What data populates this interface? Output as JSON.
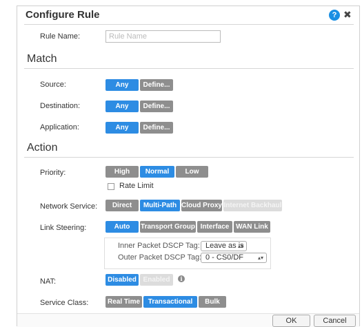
{
  "dialog": {
    "title": "Configure Rule",
    "help_glyph": "?",
    "close_glyph": "✖"
  },
  "rule_name": {
    "label": "Rule Name:",
    "placeholder": "Rule Name",
    "value": ""
  },
  "match": {
    "heading": "Match",
    "source": {
      "label": "Source:",
      "options": [
        "Any",
        "Define..."
      ],
      "selected": "Any"
    },
    "destination": {
      "label": "Destination:",
      "options": [
        "Any",
        "Define..."
      ],
      "selected": "Any"
    },
    "application": {
      "label": "Application:",
      "options": [
        "Any",
        "Define..."
      ],
      "selected": "Any"
    }
  },
  "action": {
    "heading": "Action",
    "priority": {
      "label": "Priority:",
      "options": [
        "High",
        "Normal",
        "Low"
      ],
      "selected": "Normal"
    },
    "rate_limit": {
      "label": "Rate Limit",
      "checked": false
    },
    "network_service": {
      "label": "Network Service:",
      "options": [
        "Direct",
        "Multi-Path",
        "Cloud Proxy",
        "Internet Backhaul"
      ],
      "selected": "Multi-Path",
      "disabled": [
        "Internet Backhaul"
      ]
    },
    "link_steering": {
      "label": "Link Steering:",
      "options": [
        "Auto",
        "Transport Group",
        "Interface",
        "WAN Link"
      ],
      "selected": "Auto"
    },
    "inner_dscp": {
      "label": "Inner Packet DSCP Tag:",
      "value": "Leave as is"
    },
    "outer_dscp": {
      "label": "Outer Packet DSCP Tag:",
      "value": "0 - CS0/DF"
    },
    "nat": {
      "label": "NAT:",
      "options": [
        "Disabled",
        "Enabled"
      ],
      "selected": "Disabled",
      "disabled": [
        "Enabled"
      ],
      "info_glyph": "i"
    },
    "service_class": {
      "label": "Service Class:",
      "options": [
        "Real Time",
        "Transactional",
        "Bulk"
      ],
      "selected": "Transactional"
    }
  },
  "footer": {
    "ok_label": "OK",
    "cancel_label": "Cancel"
  },
  "colors": {
    "selected": "#2d8ce3",
    "unselected": "#8e8e8e",
    "disabled": "#dcdcdc",
    "help": "#1a8fe3"
  },
  "icons": {
    "help": "help-icon",
    "close": "close-icon",
    "info": "info-icon",
    "select_arrows": "updown-chevron-icon"
  }
}
